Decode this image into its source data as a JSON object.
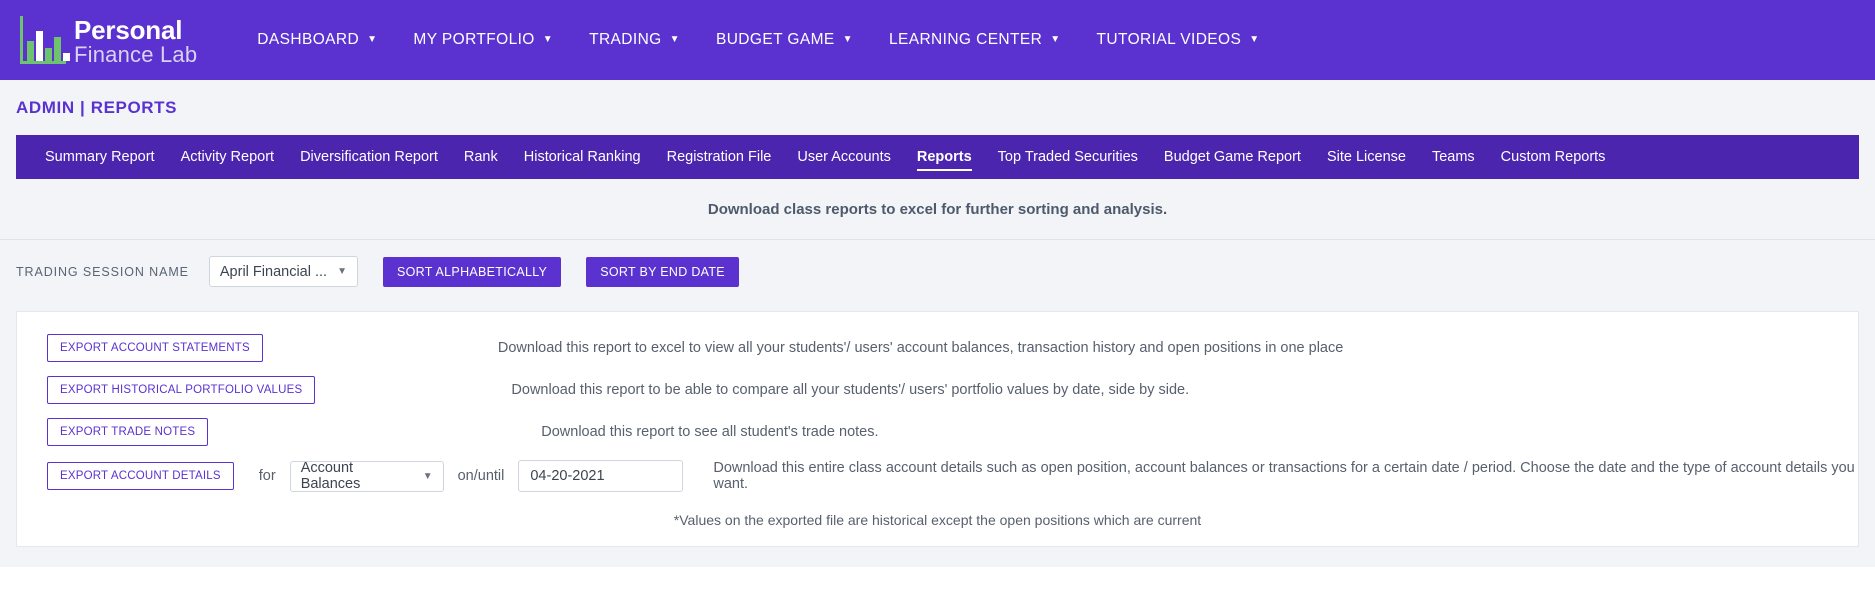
{
  "brand": {
    "line1": "Personal",
    "line2": "Finance Lab"
  },
  "topnav": {
    "items": [
      {
        "label": "DASHBOARD",
        "caret": "▼"
      },
      {
        "label": "MY PORTFOLIO",
        "caret": "▼"
      },
      {
        "label": "TRADING",
        "caret": "▼"
      },
      {
        "label": "BUDGET GAME",
        "caret": "▼"
      },
      {
        "label": "LEARNING CENTER",
        "caret": "▼"
      },
      {
        "label": "TUTORIAL VIDEOS",
        "caret": "▼"
      }
    ]
  },
  "page": {
    "title": "ADMIN | REPORTS"
  },
  "subnav": {
    "tabs": [
      {
        "label": "Summary Report",
        "active": false
      },
      {
        "label": "Activity Report",
        "active": false
      },
      {
        "label": "Diversification Report",
        "active": false
      },
      {
        "label": "Rank",
        "active": false
      },
      {
        "label": "Historical Ranking",
        "active": false
      },
      {
        "label": "Registration File",
        "active": false
      },
      {
        "label": "User Accounts",
        "active": false
      },
      {
        "label": "Reports",
        "active": true
      },
      {
        "label": "Top Traded Securities",
        "active": false
      },
      {
        "label": "Budget Game Report",
        "active": false
      },
      {
        "label": "Site License",
        "active": false
      },
      {
        "label": "Teams",
        "active": false
      },
      {
        "label": "Custom Reports",
        "active": false
      }
    ]
  },
  "intro": {
    "text": "Download class reports to excel for further sorting and analysis."
  },
  "session": {
    "label": "TRADING SESSION NAME",
    "selected": "April Financial ...",
    "caret": "▼",
    "sort_alpha_label": "SORT ALPHABETICALLY",
    "sort_enddate_label": "SORT BY END DATE"
  },
  "exports": {
    "rows": [
      {
        "button": "EXPORT ACCOUNT STATEMENTS",
        "description": "Download this report to excel to view all your students'/ users' account balances, transaction history and open positions in one place"
      },
      {
        "button": "EXPORT HISTORICAL PORTFOLIO VALUES",
        "description": "Download this report to be able to compare all your students'/ users' portfolio values by date, side by side."
      },
      {
        "button": "EXPORT TRADE NOTES",
        "description": "Download this report to see all student's trade notes."
      }
    ],
    "detail_row": {
      "button": "EXPORT ACCOUNT DETAILS",
      "word_for": "for",
      "type_selected": "Account Balances",
      "type_caret": "▼",
      "word_onuntil": "on/until",
      "date_value": "04-20-2021",
      "description": "Download this entire class account details such as open position, account balances or transactions for a certain date / period. Choose the date and the type of account details you want."
    },
    "footnote": "*Values on the exported file are historical except the open positions which are current"
  },
  "colors": {
    "brand_purple": "#5b32cf",
    "subnav_purple": "#4b25ae",
    "page_bg": "#f2f4f8",
    "logo_green": "#6ec46e"
  }
}
